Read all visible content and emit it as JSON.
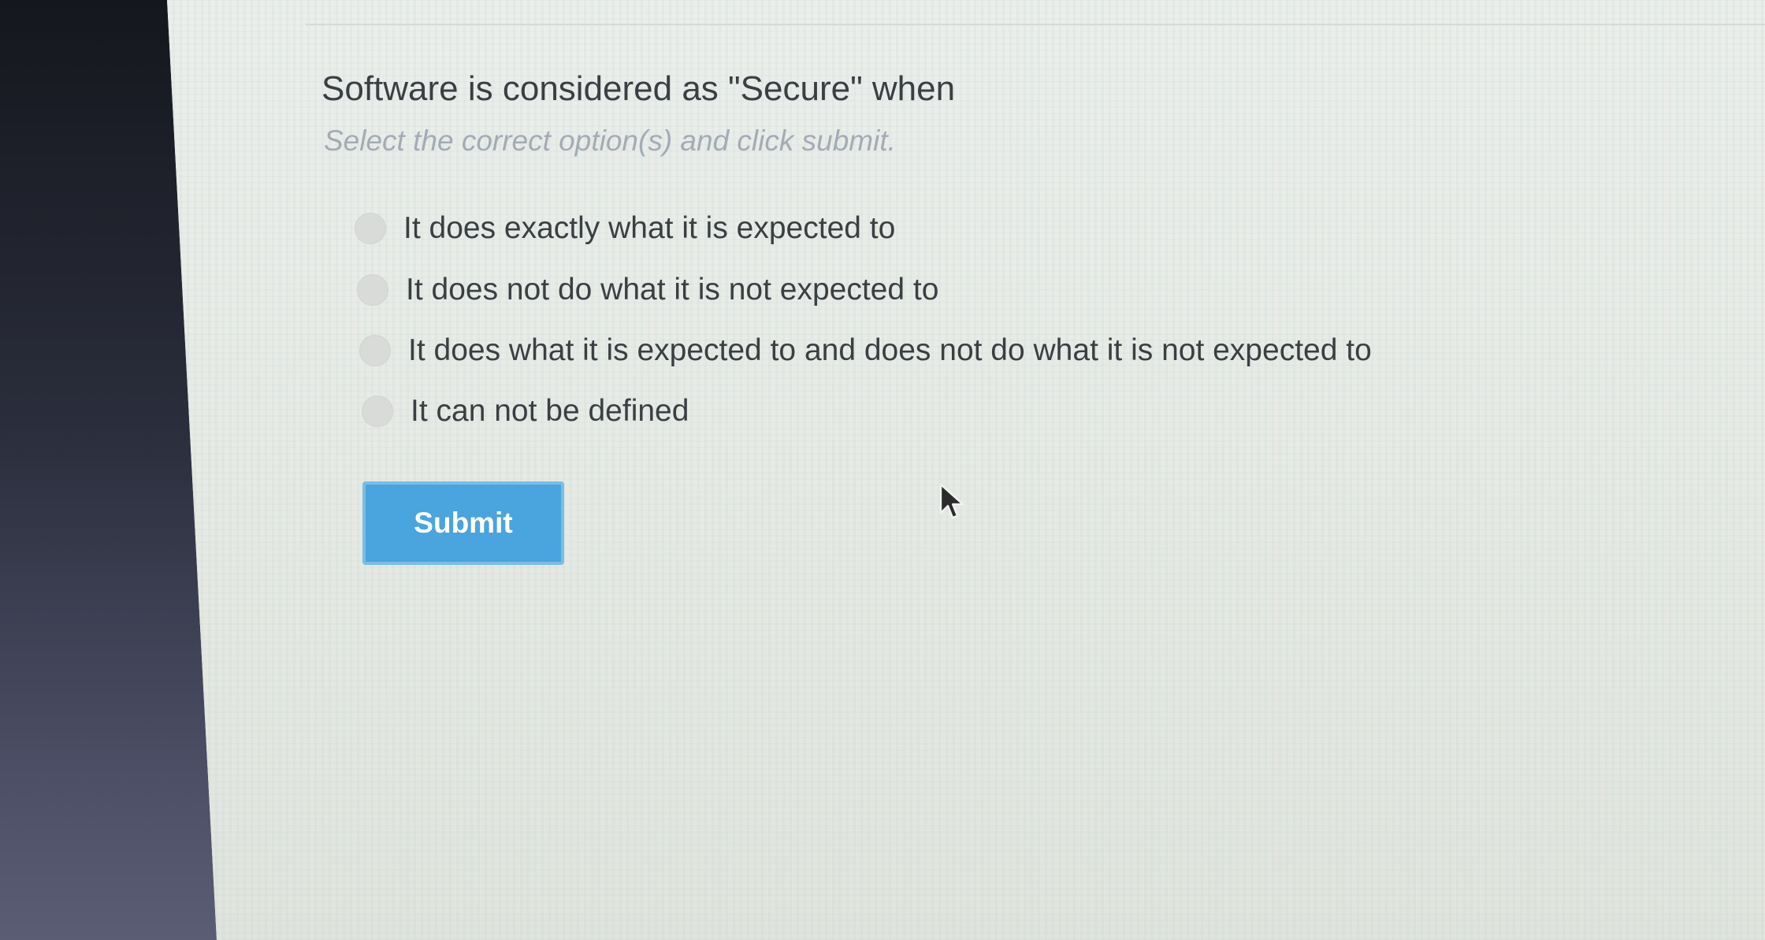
{
  "question": {
    "title": "Software is considered as \"Secure\" when",
    "instructions": "Select the correct option(s) and click submit."
  },
  "options": [
    {
      "label": "It does exactly what it is expected to",
      "selected": false
    },
    {
      "label": "It does not do what it is not expected to",
      "selected": false
    },
    {
      "label": "It does what it is expected to and does not do what it is not expected to",
      "selected": false
    },
    {
      "label": "It can not be defined",
      "selected": false
    }
  ],
  "submit": {
    "label": "Submit"
  },
  "colors": {
    "accent": "#4aa4dd",
    "question_text": "#3b3f43",
    "instruction_text": "#a4abb6"
  }
}
